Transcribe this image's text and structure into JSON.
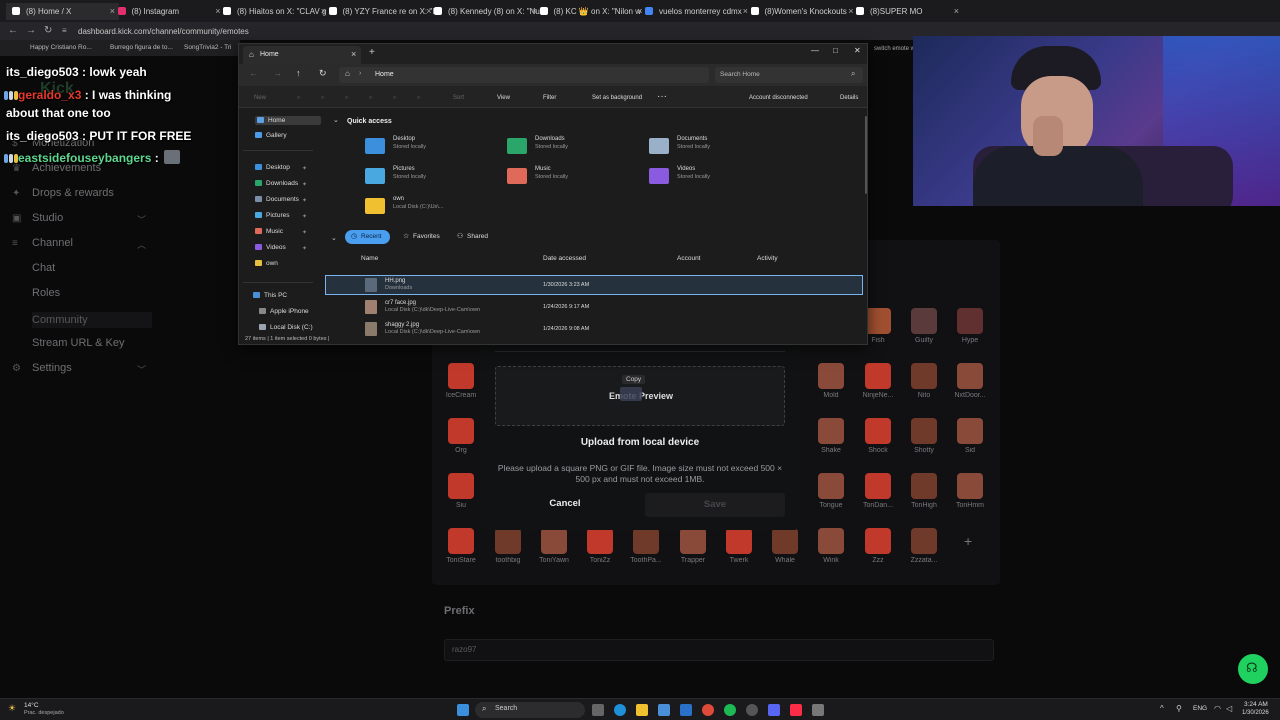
{
  "browser": {
    "tabs": [
      {
        "label": "(8) Home / X",
        "color": "#ffffff"
      },
      {
        "label": "(8) Instagram",
        "color": "#e1306c"
      },
      {
        "label": "(8) Hiaitos on X: \"CLAV g",
        "color": "#ffffff"
      },
      {
        "label": "(8) YZY France re on X: \"I",
        "color": "#ffffff"
      },
      {
        "label": "(8) Kennedy (8) on X: \"Num",
        "color": "#ffffff"
      },
      {
        "label": "(8) KC 👑 on X: \"Nilon w",
        "color": "#ffffff"
      },
      {
        "label": "vuelos monterrey cdmx",
        "color": "#4285f4"
      },
      {
        "label": "(8)Women's Knockouts",
        "color": "#ffffff"
      },
      {
        "label": "(8)SUPER MO",
        "color": "#ffffff"
      }
    ],
    "url": "dashboard.kick.com/channel/community/emotes",
    "bookmarks": [
      "Happy Cristiano Ro...",
      "Burrego figura de to...",
      "SongTrivia2 - Tri"
    ],
    "right_hint": "switch emote w"
  },
  "sidebar": {
    "items": [
      {
        "label": "Monetization",
        "icon": "dollar-icon"
      },
      {
        "label": "Achievements",
        "icon": "trophy-icon"
      },
      {
        "label": "Drops & rewards",
        "icon": "gift-icon"
      },
      {
        "label": "Studio",
        "icon": "video-icon"
      },
      {
        "label": "Channel",
        "icon": "channel-icon"
      },
      {
        "label": "Chat",
        "icon": ""
      },
      {
        "label": "Roles",
        "icon": ""
      },
      {
        "label": "Community",
        "icon": ""
      },
      {
        "label": "Stream URL & Key",
        "icon": ""
      },
      {
        "label": "Settings",
        "icon": "gear-icon"
      }
    ],
    "top_label": "Kick"
  },
  "chat_overlay": [
    {
      "user": "its_diego503",
      "message": " : lowk yeah"
    },
    {
      "user": "geraldo_x3",
      "message": " : I was thinking"
    },
    {
      "user": "",
      "message": "about that one too"
    },
    {
      "user": "its_diego503",
      "message": " : PUT IT FOR FREE"
    },
    {
      "user": "eastsidefouseybangers",
      "message": " :"
    }
  ],
  "emotes": {
    "row1": [
      "",
      "",
      "",
      "",
      "Fish",
      "Guilty",
      "Hype"
    ],
    "row2": [
      "IceCream",
      "",
      "",
      "",
      "",
      "",
      "",
      "",
      "Mold",
      "NinjeNe...",
      "Nito",
      "NxtDoor..."
    ],
    "row3": [
      "Org",
      "",
      "",
      "",
      "",
      "",
      "",
      "",
      "Shake",
      "Shock",
      "Shotty",
      "Sid"
    ],
    "row4": [
      "Siu",
      "",
      "",
      "",
      "",
      "",
      "",
      "",
      "Tongue",
      "TonDan...",
      "TonHigh",
      "TonHmm"
    ],
    "row5": [
      "ToniStare",
      "toothbig",
      "ToniYawn",
      "ToniZz",
      "ToothPa...",
      "Trapper",
      "Twerk",
      "Whale",
      "Wink",
      "Zzz",
      "Zzzata..."
    ],
    "add": "+"
  },
  "prefix": {
    "label": "Prefix",
    "value": "razo97"
  },
  "modal": {
    "preview_title": "Emote Preview",
    "drag_hint": "Copy",
    "upload_title": "Upload from local device",
    "upload_desc": "Please upload a square PNG or GIF file. Image size must not exceed 500 × 500 px and must not exceed 1MB.",
    "cancel": "Cancel",
    "save": "Save"
  },
  "explorer": {
    "tab_title": "Home",
    "address": "Home",
    "search_placeholder": "Search Home",
    "toolbar": {
      "new": "New",
      "sort": "Sort",
      "view": "View",
      "filter": "Filter",
      "set_bg": "Set as background",
      "account": "Account disconnected",
      "details": "Details"
    },
    "nav_pane": [
      {
        "label": "Home",
        "color": "#5aa0e6"
      },
      {
        "label": "Gallery",
        "color": "#4d9ae8"
      },
      {
        "label": "Desktop",
        "color": "#3b8fdc"
      },
      {
        "label": "Downloads",
        "color": "#2aa66a"
      },
      {
        "label": "Documents",
        "color": "#7a8ea8"
      },
      {
        "label": "Pictures",
        "color": "#4aa8e0"
      },
      {
        "label": "Music",
        "color": "#e06a5a"
      },
      {
        "label": "Videos",
        "color": "#8a5ae0"
      },
      {
        "label": "own",
        "color": "#e8c040"
      },
      {
        "label": "This PC",
        "color": "#4a90d9"
      },
      {
        "label": "Apple iPhone",
        "color": "#888888"
      },
      {
        "label": "Local Disk (C:)",
        "color": "#9aa4b0"
      }
    ],
    "quick_access_title": "Quick access",
    "quick_access": [
      {
        "name": "Desktop",
        "sub": "Stored locally",
        "color": "#3b8fdc"
      },
      {
        "name": "Downloads",
        "sub": "Stored locally",
        "color": "#2aa66a"
      },
      {
        "name": "Documents",
        "sub": "Stored locally",
        "color": "#9ab0c8"
      },
      {
        "name": "Pictures",
        "sub": "Stored locally",
        "color": "#4aa8e0"
      },
      {
        "name": "Music",
        "sub": "Stored locally",
        "color": "#e06a5a"
      },
      {
        "name": "Videos",
        "sub": "Stored locally",
        "color": "#8a5ae0"
      },
      {
        "name": "own",
        "sub": "Local Disk (C:)\\Us\\...",
        "color": "#f0c030"
      }
    ],
    "filters": [
      "Recent",
      "Favorites",
      "Shared"
    ],
    "columns": [
      "Name",
      "Date accessed",
      "Account",
      "Activity"
    ],
    "files": [
      {
        "name": "HH.png",
        "location": "Downloads",
        "date": "1/30/2026 3:23 AM"
      },
      {
        "name": "cr7 face.jpg",
        "location": "Local Disk (C:)\\dk\\Deep-Live-Cam\\own",
        "date": "1/24/2026 9:17 AM"
      },
      {
        "name": "shaggy 2.jpg",
        "location": "Local Disk (C:)\\dk\\Deep-Live-Cam\\own",
        "date": "1/24/2026 9:08 AM"
      }
    ],
    "status": "27 items  |  1 item selected  0 bytes  |"
  },
  "taskbar": {
    "weather_temp": "14°C",
    "weather_desc": "Prac. despejado",
    "search": "Search",
    "lang": "ENG",
    "time": "3:24 AM",
    "date": "1/30/2026"
  }
}
